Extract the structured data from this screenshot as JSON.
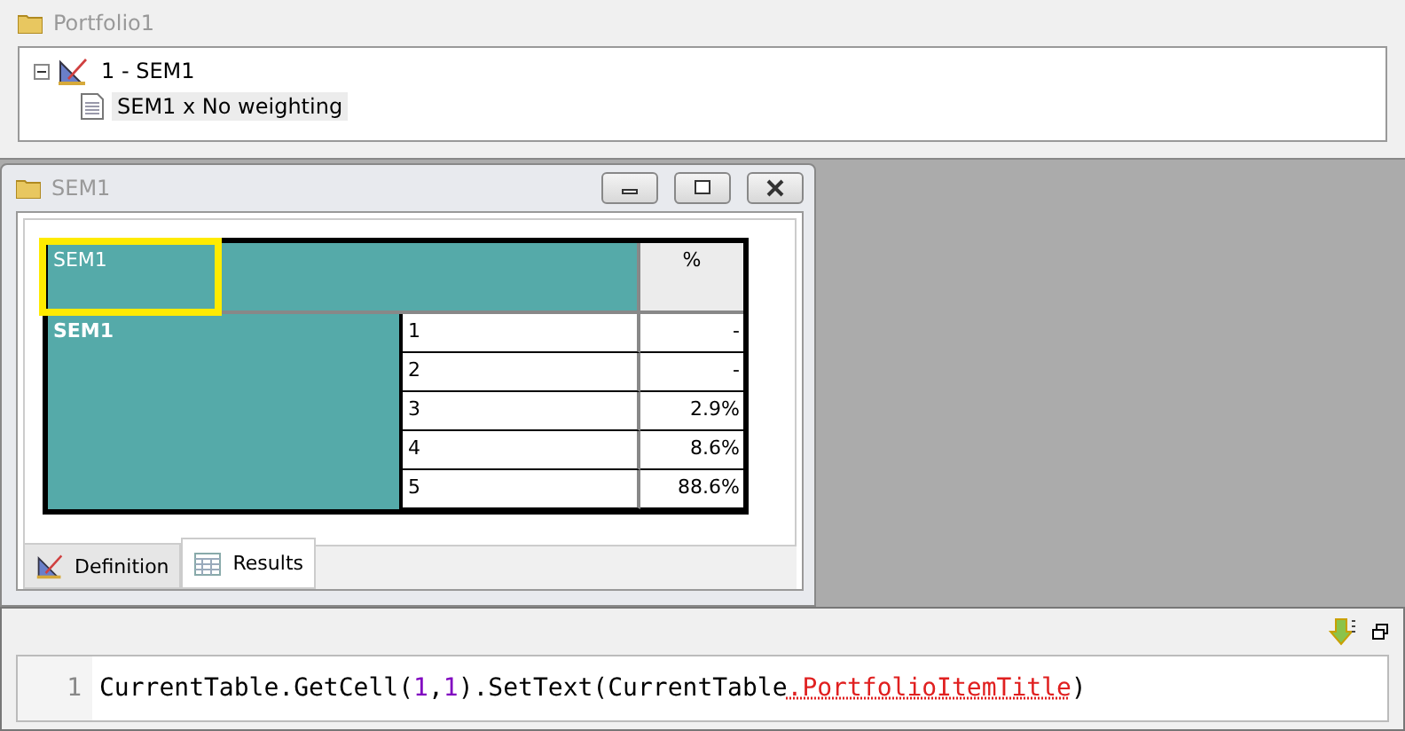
{
  "portfolio_window": {
    "title": "Portfolio1",
    "tree": [
      {
        "label": "1 - SEM1",
        "expanded": true,
        "children": [
          {
            "label": "SEM1 x No weighting",
            "selected": true
          }
        ]
      }
    ]
  },
  "table_window": {
    "title": "SEM1",
    "table": {
      "header": {
        "label": "SEM1",
        "selected": true,
        "column_3": "%"
      },
      "group": "SEM1",
      "rows": [
        {
          "category": "1",
          "value": "-"
        },
        {
          "category": "2",
          "value": "-"
        },
        {
          "category": "3",
          "value": "2.9%"
        },
        {
          "category": "4",
          "value": "8.6%"
        },
        {
          "category": "5",
          "value": "88.6%"
        }
      ]
    },
    "tabs": [
      {
        "label": "Definition",
        "selected": false
      },
      {
        "label": "Results",
        "selected": true
      }
    ]
  },
  "script_editor": {
    "line_number": "1",
    "tokens": [
      {
        "kind": "plain",
        "text": "CurrentTable.GetCell("
      },
      {
        "kind": "number",
        "text": "1"
      },
      {
        "kind": "plain",
        "text": ","
      },
      {
        "kind": "number",
        "text": "1"
      },
      {
        "kind": "plain",
        "text": ").SetText(CurrentTable"
      },
      {
        "kind": "error",
        "text": ".PortfolioItemTitle"
      },
      {
        "kind": "plain",
        "text": ")"
      }
    ]
  }
}
